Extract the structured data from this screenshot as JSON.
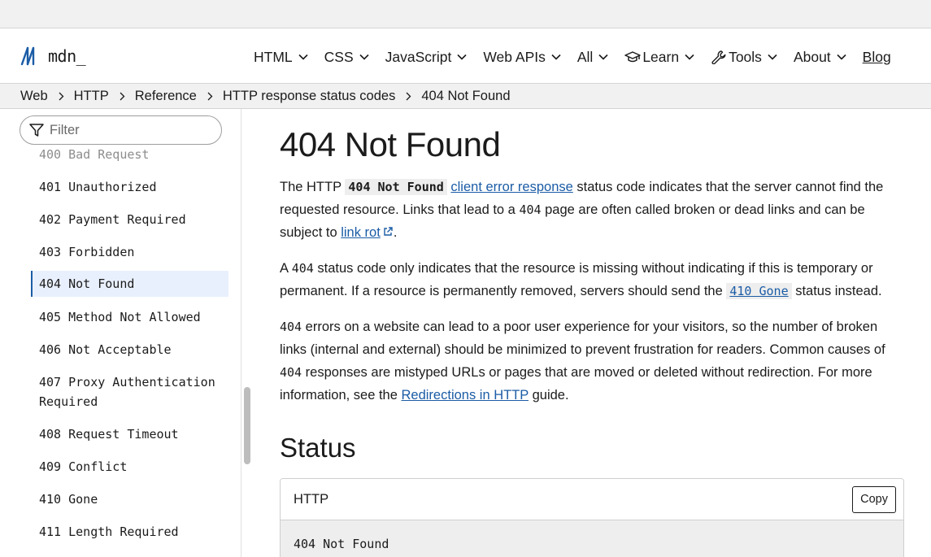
{
  "header": {
    "logo_text": "mdn_",
    "nav": [
      {
        "label": "HTML"
      },
      {
        "label": "CSS"
      },
      {
        "label": "JavaScript"
      },
      {
        "label": "Web APIs"
      },
      {
        "label": "All"
      },
      {
        "label": "Learn",
        "icon": "graduation-cap-icon"
      },
      {
        "label": "Tools",
        "icon": "wrench-icon"
      },
      {
        "label": "About"
      }
    ],
    "blog_label": "Blog"
  },
  "breadcrumb": [
    "Web",
    "HTTP",
    "Reference",
    "HTTP response status codes",
    "404 Not Found"
  ],
  "sidebar": {
    "filter_placeholder": "Filter",
    "items": [
      {
        "label": "400 Bad Request",
        "state": "faded"
      },
      {
        "label": "401 Unauthorized"
      },
      {
        "label": "402 Payment Required"
      },
      {
        "label": "403 Forbidden"
      },
      {
        "label": "404 Not Found",
        "state": "active"
      },
      {
        "label": "405 Method Not Allowed"
      },
      {
        "label": "406 Not Acceptable"
      },
      {
        "label": "407 Proxy Authentication",
        "label2": "Required"
      },
      {
        "label": "408 Request Timeout"
      },
      {
        "label": "409 Conflict"
      },
      {
        "label": "410 Gone"
      },
      {
        "label": "411 Length Required"
      }
    ]
  },
  "article": {
    "title": "404 Not Found",
    "p1": {
      "t1": "The HTTP ",
      "code": "404 Not Found",
      "t2": " ",
      "link": "client error response",
      "t3": " status code indicates that the server cannot find the requested resource. Links that lead to a ",
      "code2": "404",
      "t4": " page are often called broken or dead links and can be subject to ",
      "link2": "link rot",
      "t5": "."
    },
    "p2": {
      "t1": "A ",
      "code": "404",
      "t2": " status code only indicates that the resource is missing without indicating if this is temporary or permanent. If a resource is permanently removed, servers should send the ",
      "code_link": "410 Gone",
      "t3": " status instead."
    },
    "p3": {
      "code": "404",
      "t1": " errors on a website can lead to a poor user experience for your visitors, so the number of broken links (internal and external) should be minimized to prevent frustration for readers. Common causes of ",
      "code2": "404",
      "t2": " responses are mistyped URLs or pages that are moved or deleted without redirection. For more information, see the ",
      "link": "Redirections in HTTP",
      "t3": " guide."
    },
    "status_heading": "Status",
    "code_block": {
      "language": "HTTP",
      "copy_label": "Copy",
      "code": "404 Not Found"
    }
  },
  "colors": {
    "link": "#1b5ca6",
    "active_bg": "#e9f0fd",
    "strip_bg": "#f2f1f1"
  }
}
